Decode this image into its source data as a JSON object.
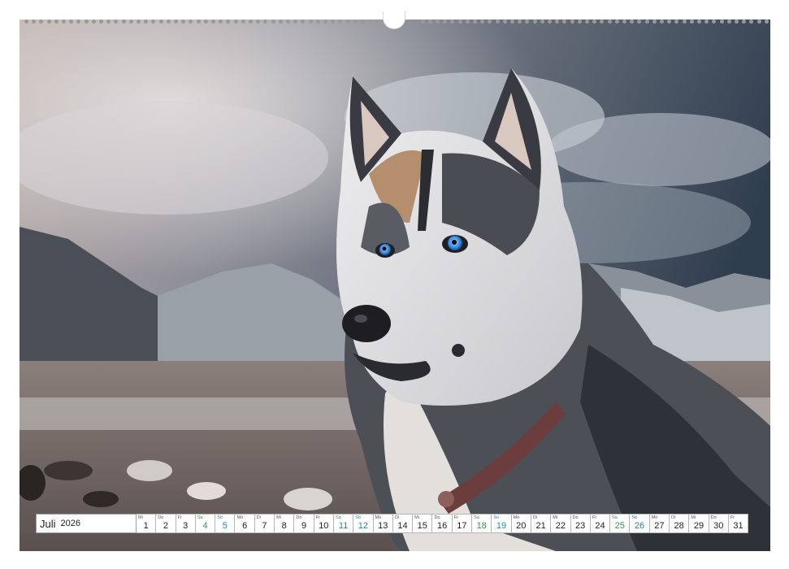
{
  "calendar": {
    "month": "Juli",
    "year": "2026",
    "days": [
      {
        "wd": "Mi",
        "num": "1",
        "type": "weekday"
      },
      {
        "wd": "Do",
        "num": "2",
        "type": "weekday"
      },
      {
        "wd": "Fr",
        "num": "3",
        "type": "weekday"
      },
      {
        "wd": "Sa",
        "num": "4",
        "type": "sat"
      },
      {
        "wd": "So",
        "num": "5",
        "type": "sun"
      },
      {
        "wd": "Mo",
        "num": "6",
        "type": "weekday"
      },
      {
        "wd": "Di",
        "num": "7",
        "type": "weekday"
      },
      {
        "wd": "Mi",
        "num": "8",
        "type": "weekday"
      },
      {
        "wd": "Do",
        "num": "9",
        "type": "weekday"
      },
      {
        "wd": "Fr",
        "num": "10",
        "type": "weekday"
      },
      {
        "wd": "Sa",
        "num": "11",
        "type": "sat"
      },
      {
        "wd": "So",
        "num": "12",
        "type": "sun"
      },
      {
        "wd": "Mo",
        "num": "13",
        "type": "weekday"
      },
      {
        "wd": "Di",
        "num": "14",
        "type": "weekday"
      },
      {
        "wd": "Mi",
        "num": "15",
        "type": "weekday"
      },
      {
        "wd": "Do",
        "num": "16",
        "type": "weekday"
      },
      {
        "wd": "Fr",
        "num": "17",
        "type": "weekday"
      },
      {
        "wd": "Sa",
        "num": "18",
        "type": "sat"
      },
      {
        "wd": "So",
        "num": "19",
        "type": "sun"
      },
      {
        "wd": "Mo",
        "num": "20",
        "type": "weekday"
      },
      {
        "wd": "Di",
        "num": "21",
        "type": "weekday"
      },
      {
        "wd": "Mi",
        "num": "22",
        "type": "weekday"
      },
      {
        "wd": "Do",
        "num": "23",
        "type": "weekday"
      },
      {
        "wd": "Fr",
        "num": "24",
        "type": "weekday"
      },
      {
        "wd": "Sa",
        "num": "25",
        "type": "sat"
      },
      {
        "wd": "So",
        "num": "26",
        "type": "sun"
      },
      {
        "wd": "Mo",
        "num": "27",
        "type": "weekday"
      },
      {
        "wd": "Di",
        "num": "28",
        "type": "weekday"
      },
      {
        "wd": "Mi",
        "num": "29",
        "type": "weekday"
      },
      {
        "wd": "Do",
        "num": "30",
        "type": "weekday"
      },
      {
        "wd": "Fr",
        "num": "31",
        "type": "weekday"
      }
    ]
  },
  "colors": {
    "saturday": "#2f9a52",
    "sunday": "#2a86b8"
  },
  "image": {
    "subject": "husky-dog-photo"
  }
}
